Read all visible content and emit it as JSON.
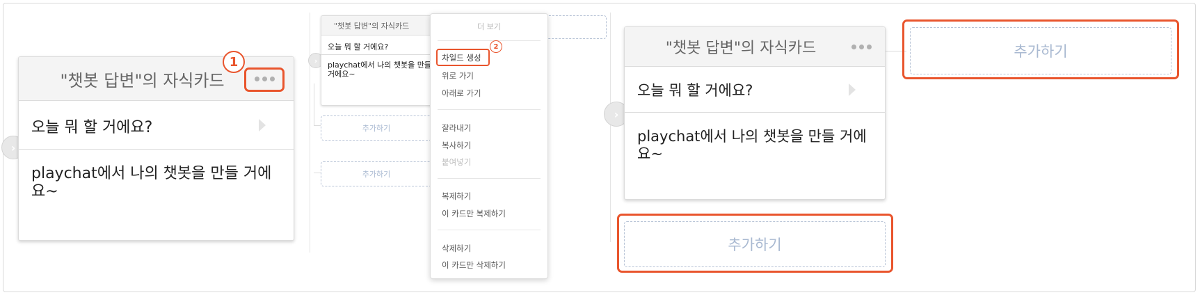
{
  "card": {
    "title": "\"챗봇 답변\"의 자식카드",
    "row1": "오늘 뭐 할 거에요?",
    "row2": "playchat에서 나의 챗봇을 만들 거에요~"
  },
  "add_label": "추가하기",
  "callouts": {
    "step1": "1",
    "step2": "2"
  },
  "menu": {
    "title": "더 보기",
    "items": [
      "차일드 생성",
      "위로 가기",
      "아래로 가기",
      "잘라내기",
      "복사하기",
      "붙여넣기",
      "복제하기",
      "이 카드만 복제하기",
      "삭제하기",
      "이 카드만 삭제하기"
    ]
  },
  "colors": {
    "highlight": "#e9552d",
    "add_text": "#a9b9d1"
  }
}
